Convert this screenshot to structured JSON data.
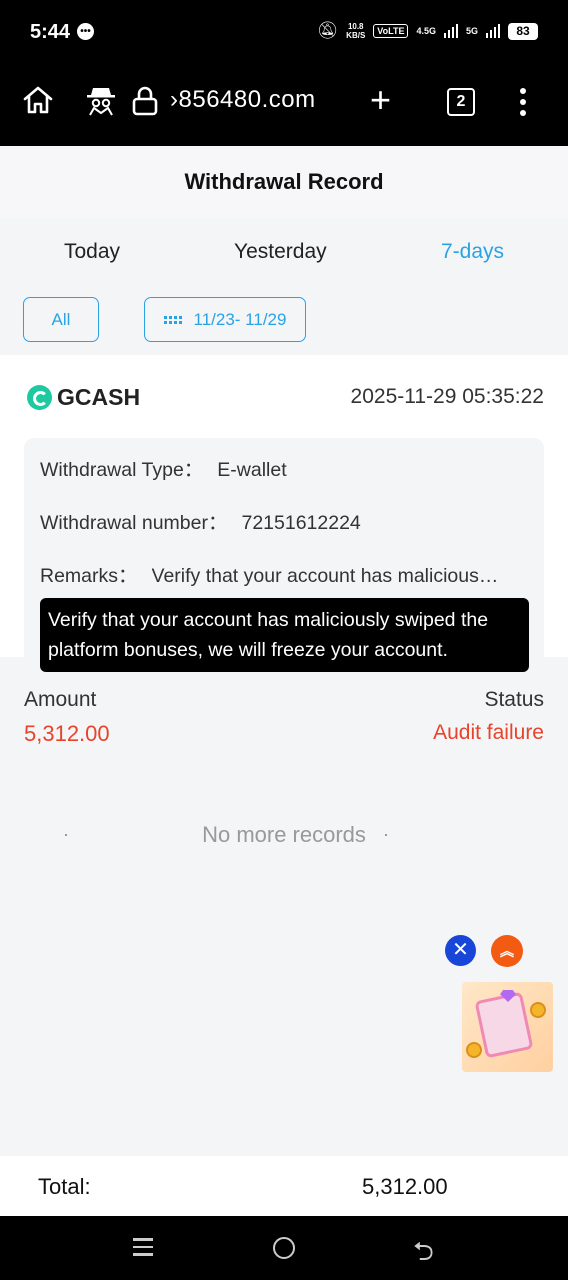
{
  "status_bar": {
    "time": "5:44",
    "chat_icon": "chat-bubble-icon",
    "speed": "10.8\nKB/S",
    "volte": "VoLTE",
    "net1": "4.5G",
    "net2": "5G",
    "battery": "83"
  },
  "browser": {
    "url": "›856480.com",
    "tab_count": "2",
    "icons": [
      "home-icon",
      "incognito-icon",
      "lock-icon",
      "plus-icon",
      "tabs-icon",
      "menu-icon"
    ]
  },
  "header": {
    "title": "Withdrawal Record"
  },
  "tabs": [
    {
      "label": "Today"
    },
    {
      "label": "Yesterday"
    },
    {
      "label": "7-days",
      "active": true
    }
  ],
  "filters": {
    "all_label": "All",
    "date_range": "11/23- 11/29"
  },
  "record": {
    "method": "GCASH",
    "datetime": "2025-11-29 05:35:22",
    "type_label": "Withdrawal Type：",
    "type_value": "E-wallet",
    "number_label": "Withdrawal number：",
    "number_value": "72151612224",
    "remarks_label": "Remarks：",
    "remarks_value": "Verify that your account has malicious…",
    "tooltip": "Verify that your account has maliciously swiped the platform bonuses, we will freeze your account.",
    "amount_label": "Amount",
    "amount_value": "5,312.00",
    "status_label": "Status",
    "status_value": "Audit failure"
  },
  "list_end": "No more records",
  "floating": {
    "close": "✕",
    "top": "︽"
  },
  "total": {
    "label": "Total:",
    "value": "5,312.00"
  },
  "colors": {
    "accent": "#2aa3e6",
    "error": "#e8432b",
    "gcash": "#1dc9a0"
  }
}
